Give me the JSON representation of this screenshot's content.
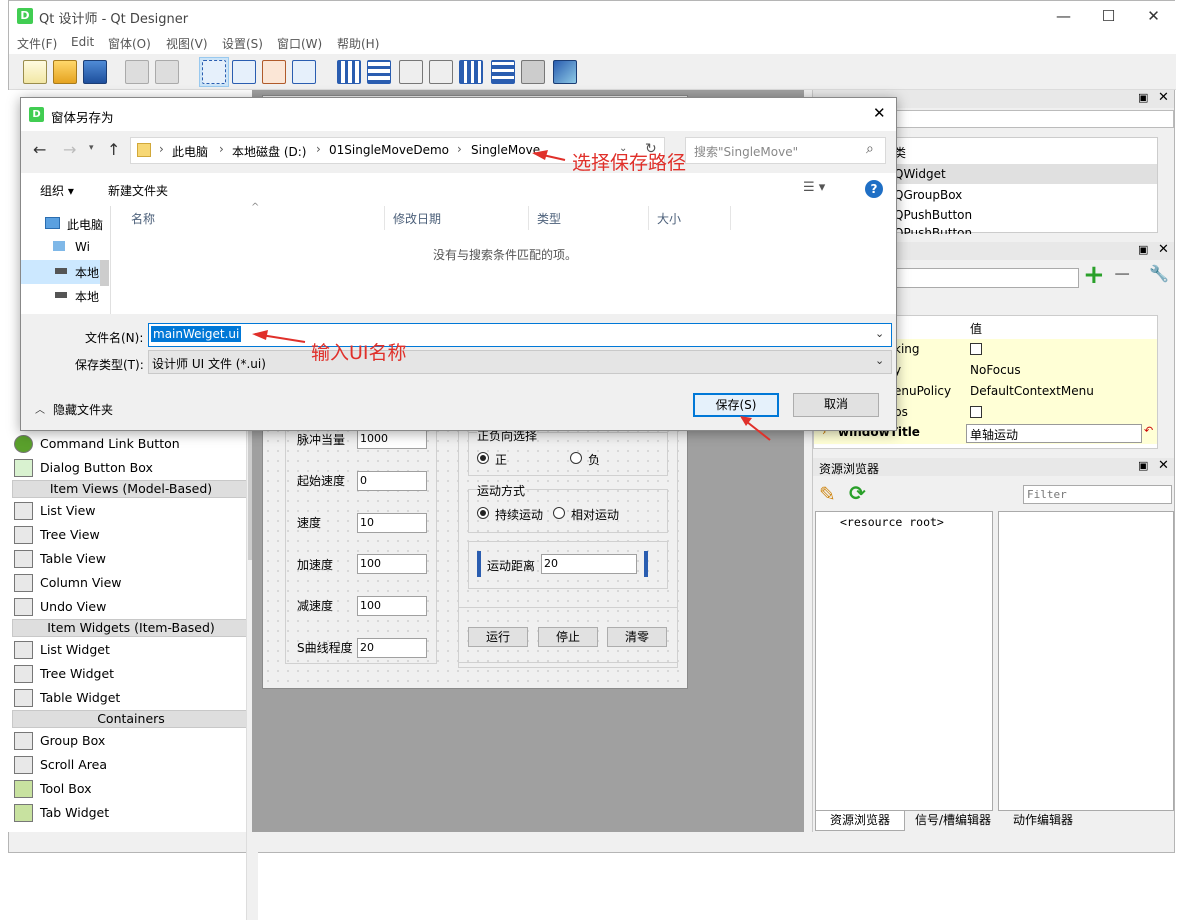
{
  "app": {
    "title": "Qt 设计师 - Qt Designer",
    "icon_letter": "D"
  },
  "window_controls": {
    "minimize": "—",
    "maximize": "☐",
    "close": "✕"
  },
  "menu": [
    "文件(F)",
    "Edit",
    "窗体(O)",
    "视图(V)",
    "设置(S)",
    "窗口(W)",
    "帮助(H)"
  ],
  "widget_box": {
    "items_top": [
      "Command Link Button",
      "Dialog Button Box"
    ],
    "cat_item_views": "Item Views (Model-Based)",
    "item_views": [
      "List View",
      "Tree View",
      "Table View",
      "Column View",
      "Undo View"
    ],
    "cat_item_widgets": "Item Widgets (Item-Based)",
    "item_widgets": [
      "List Widget",
      "Tree Widget",
      "Table Widget"
    ],
    "cat_containers": "Containers",
    "containers": [
      "Group Box",
      "Scroll Area",
      "Tool Box",
      "Tab Widget"
    ]
  },
  "form": {
    "labels": [
      "脉冲当量",
      "起始速度",
      "速度",
      "加速度",
      "减速度",
      "S曲线程度"
    ],
    "values": [
      "1000",
      "0",
      "10",
      "100",
      "100",
      "20"
    ],
    "dir_group": "正负向选择",
    "dir_pos": "正",
    "dir_neg": "负",
    "mode_group": "运动方式",
    "mode_cont": "持续运动",
    "mode_rel": "相对运动",
    "dist_label": "运动距离",
    "dist_value": "20",
    "btn_run": "运行",
    "btn_stop": "停止",
    "btn_clear": "清零"
  },
  "right": {
    "obj_class_hdr": "类",
    "obj_rows": [
      "QWidget",
      "QGroupBox",
      "QPushButton",
      "QPushButton"
    ],
    "prop_value_hdr": "值",
    "prop_rows": [
      {
        "name": "king",
        "value": ""
      },
      {
        "name": "y",
        "value": "NoFocus"
      },
      {
        "name": "enuPolicy",
        "value": "DefaultContextMenu"
      },
      {
        "name": "ps",
        "value": ""
      },
      {
        "name": "windowTitle",
        "value": "单轴运动"
      }
    ],
    "res_title": "资源浏览器",
    "res_filter": "Filter",
    "res_root": "<resource root>",
    "tabs": [
      "资源浏览器",
      "信号/槽编辑器",
      "动作编辑器"
    ]
  },
  "dialog": {
    "title": "窗体另存为",
    "breadcrumb": [
      "此电脑",
      "本地磁盘 (D:)",
      "01SingleMoveDemo",
      "SingleMove"
    ],
    "search_placeholder": "搜索\"SingleMove\"",
    "organize": "组织 ▾",
    "new_folder": "新建文件夹",
    "nav": [
      "此电脑",
      "Wi",
      "本地",
      "本地"
    ],
    "columns": [
      "名称",
      "修改日期",
      "类型",
      "大小"
    ],
    "empty_msg": "没有与搜索条件匹配的项。",
    "filename_label": "文件名(N):",
    "filename_value": "mainWeiget.ui",
    "filetype_label": "保存类型(T):",
    "filetype_value": "设计师 UI 文件 (*.ui)",
    "hide_folders": "隐藏文件夹",
    "save": "保存(S)",
    "cancel": "取消"
  },
  "annotations": {
    "path": "选择保存路径",
    "name": "输入UI名称"
  },
  "colors": {
    "accent": "#0078d7",
    "annot": "#e0302a",
    "qt_green": "#41cd52",
    "prop_highlight": "#ffffd6"
  }
}
